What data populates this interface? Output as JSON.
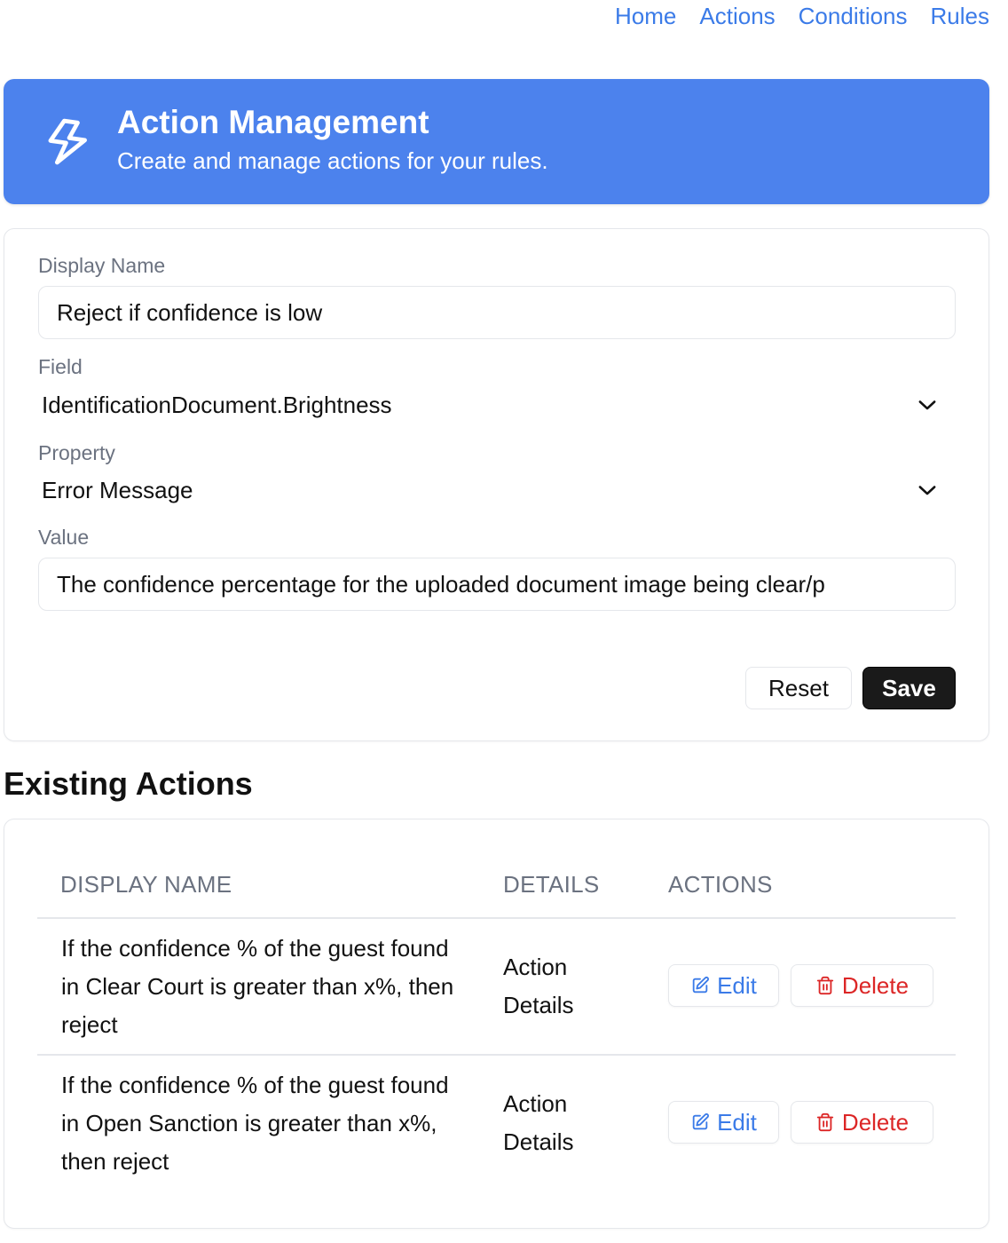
{
  "nav": {
    "links": [
      "Home",
      "Actions",
      "Conditions",
      "Rules"
    ]
  },
  "header": {
    "icon": "lightning-bolt-icon",
    "title": "Action Management",
    "subtitle": "Create and manage actions for your rules."
  },
  "form": {
    "display_name_label": "Display Name",
    "display_name_value": "Reject if confidence is low",
    "field_label": "Field",
    "field_value": "IdentificationDocument.Brightness",
    "property_label": "Property",
    "property_value": "Error Message",
    "value_label": "Value",
    "value_value": "The confidence percentage for the uploaded document image being clear/p",
    "reset_label": "Reset",
    "save_label": "Save"
  },
  "existing": {
    "title": "Existing Actions",
    "columns": [
      "DISPLAY NAME",
      "DETAILS",
      "ACTIONS"
    ],
    "rows": [
      {
        "name": "If the confidence % of the guest found in Clear Court is greater than x%, then reject",
        "details": "Action Details",
        "edit_label": "Edit",
        "delete_label": "Delete"
      },
      {
        "name": "If the confidence % of the guest found in Open Sanction is greater than x%, then reject",
        "details": "Action Details",
        "edit_label": "Edit",
        "delete_label": "Delete"
      }
    ]
  },
  "colors": {
    "accent": "#4c82ed",
    "link": "#3b7be8",
    "danger": "#dc2626",
    "primary_button": "#1a1a1a"
  }
}
